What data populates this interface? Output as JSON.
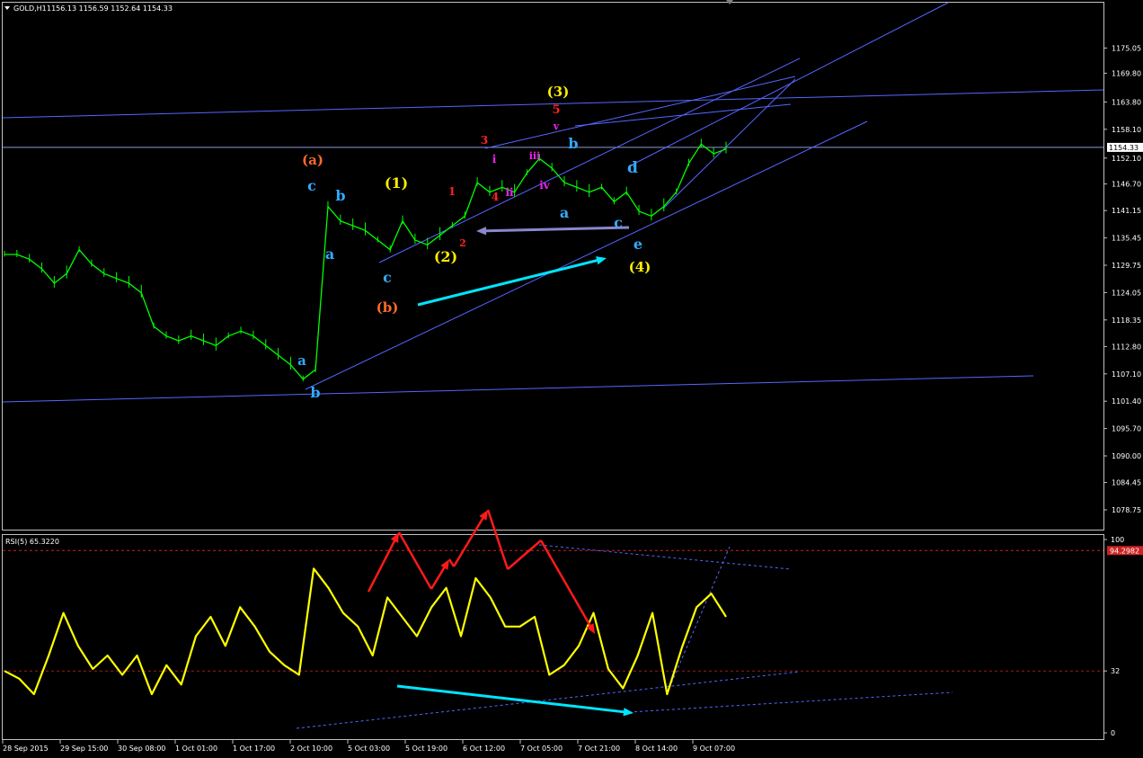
{
  "header": {
    "symbol": "GOLD,H1",
    "ohlc": "1156.13 1156.59 1152.64 1154.33"
  },
  "price_panel": {
    "ylim": [
      1075.0,
      1180.0
    ],
    "tick_labels": [
      "1175.05",
      "1169.80",
      "1163.80",
      "1158.10",
      "1152.10",
      "1146.70",
      "1141.15",
      "1135.45",
      "1129.75",
      "1124.05",
      "1118.35",
      "1112.80",
      "1107.10",
      "1101.40",
      "1095.70",
      "1090.00",
      "1084.45",
      "1078.75"
    ],
    "last_price_label": "1154.33",
    "last_price": 1154.33
  },
  "rsi_panel": {
    "title": "RSI(5) 65.3220",
    "ylim": [
      0,
      100
    ],
    "tick_labels": [
      "100",
      "32",
      "0"
    ],
    "level_label": "94.2982",
    "level_high": 94.2982,
    "level_low": 32
  },
  "time_axis": {
    "labels": [
      "28 Sep 2015",
      "29 Sep 15:00",
      "30 Sep 08:00",
      "1 Oct 01:00",
      "1 Oct 17:00",
      "2 Oct 10:00",
      "5 Oct 03:00",
      "5 Oct 19:00",
      "6 Oct 12:00",
      "7 Oct 05:00",
      "7 Oct 21:00",
      "8 Oct 14:00",
      "9 Oct 07:00"
    ]
  },
  "wave_labels": [
    {
      "text": "(a)",
      "color": "#ff6a2a"
    },
    {
      "text": "c",
      "color": "#33aaff"
    },
    {
      "text": "b",
      "color": "#33aaff"
    },
    {
      "text": "a",
      "color": "#33aaff"
    },
    {
      "text": "a",
      "color": "#33aaff"
    },
    {
      "text": "b",
      "color": "#33aaff"
    },
    {
      "text": "(b)",
      "color": "#ff6a2a"
    },
    {
      "text": "(1)",
      "color": "#ffee00"
    },
    {
      "text": "(2)",
      "color": "#ffee00"
    },
    {
      "text": "c",
      "color": "#33aaff"
    },
    {
      "text": "1",
      "color": "#ff2222"
    },
    {
      "text": "2",
      "color": "#ff2222"
    },
    {
      "text": "3",
      "color": "#ff2222"
    },
    {
      "text": "4",
      "color": "#ff2222"
    },
    {
      "text": "5",
      "color": "#ff2222"
    },
    {
      "text": "(3)",
      "color": "#ffee00"
    },
    {
      "text": "i",
      "color": "#ee22ee"
    },
    {
      "text": "ii",
      "color": "#ee22ee"
    },
    {
      "text": "iii",
      "color": "#ee22ee"
    },
    {
      "text": "iv",
      "color": "#ee22ee"
    },
    {
      "text": "v",
      "color": "#ee22ee"
    },
    {
      "text": "b",
      "color": "#33aaff"
    },
    {
      "text": "a",
      "color": "#33aaff"
    },
    {
      "text": "c",
      "color": "#33aaff"
    },
    {
      "text": "d",
      "color": "#33aaff"
    },
    {
      "text": "e",
      "color": "#33aaff"
    },
    {
      "text": "(4)",
      "color": "#ffee00"
    }
  ],
  "colors": {
    "background": "#000000",
    "candles": "#00ff00",
    "rsi_line": "#ffff00",
    "trendlines": "#5566ff",
    "arrow_cyan": "#00e5ff",
    "arrow_gray": "#8888cc",
    "arrow_red": "#ff1a1a",
    "level_line": "#cc2222"
  },
  "chart_data": {
    "type": "line",
    "series": [
      {
        "values": [
          1132,
          1132,
          1131,
          1129,
          1126,
          1128,
          1133,
          1130,
          1128,
          1127,
          1126,
          1124,
          1117,
          1115,
          1114,
          1115,
          1114,
          1113,
          1115,
          1116,
          1115,
          1113,
          1111,
          1109,
          1106,
          1108,
          1142,
          1139,
          1138,
          1137,
          1135,
          1133,
          1139,
          1135,
          1134,
          1136,
          1138,
          1140,
          1147,
          1145,
          1146,
          1145,
          1149,
          1152,
          1150,
          1147,
          1146,
          1145,
          1146,
          1143,
          1145,
          1141,
          1140,
          1142,
          1145,
          1151,
          1155,
          1153,
          1154
        ]
      },
      {
        "values": [
          32,
          28,
          20,
          40,
          62,
          45,
          33,
          40,
          30,
          40,
          20,
          35,
          25,
          50,
          60,
          45,
          65,
          55,
          42,
          35,
          30,
          85,
          75,
          62,
          55,
          40,
          70,
          60,
          50,
          65,
          75,
          50,
          80,
          70,
          55,
          55,
          60,
          30,
          35,
          45,
          62,
          33,
          23,
          40,
          62,
          20,
          44,
          65,
          72,
          60
        ]
      }
    ]
  }
}
